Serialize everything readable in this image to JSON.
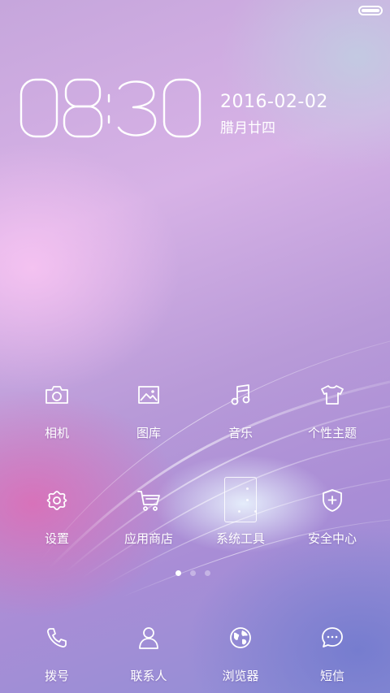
{
  "status_bar": {
    "battery_level": 1.0,
    "battery_icon": "battery-icon"
  },
  "clock": {
    "time": "08:30",
    "date": "2016-02-02",
    "lunar_date": "腊月廿四"
  },
  "apps_row1": [
    {
      "label": "相机",
      "icon": "camera-icon"
    },
    {
      "label": "图库",
      "icon": "gallery-icon"
    },
    {
      "label": "音乐",
      "icon": "music-icon"
    },
    {
      "label": "个性主题",
      "icon": "theme-tshirt-icon"
    }
  ],
  "apps_row2": [
    {
      "label": "设置",
      "icon": "settings-gear-icon"
    },
    {
      "label": "应用商店",
      "icon": "app-store-cart-icon"
    },
    {
      "label": "系统工具",
      "icon": "folder-icon"
    },
    {
      "label": "安全中心",
      "icon": "security-shield-icon"
    }
  ],
  "page_indicator": {
    "pages": 3,
    "current": 1
  },
  "dock": [
    {
      "label": "拨号",
      "icon": "phone-icon"
    },
    {
      "label": "联系人",
      "icon": "contacts-icon"
    },
    {
      "label": "浏览器",
      "icon": "browser-globe-icon"
    },
    {
      "label": "短信",
      "icon": "messages-icon"
    }
  ],
  "colors": {
    "text": "#ffffff"
  }
}
